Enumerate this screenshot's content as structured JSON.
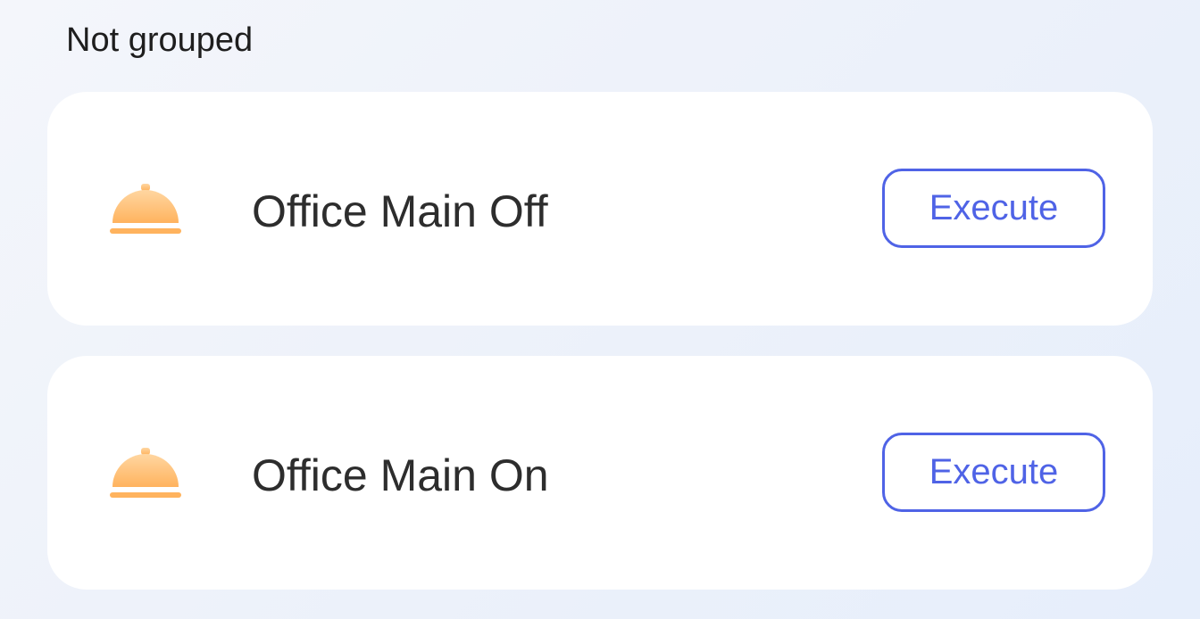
{
  "section": {
    "title": "Not grouped"
  },
  "scenes": [
    {
      "name": "Office Main Off",
      "icon": "cloche-icon",
      "button_label": "Execute"
    },
    {
      "name": "Office Main On",
      "icon": "cloche-icon",
      "button_label": "Execute"
    }
  ],
  "colors": {
    "accent": "#4f63e6",
    "icon_gradient_top": "#ffd39a",
    "icon_gradient_bottom": "#ffb25c",
    "text": "#2d2d2d",
    "card": "#ffffff"
  }
}
